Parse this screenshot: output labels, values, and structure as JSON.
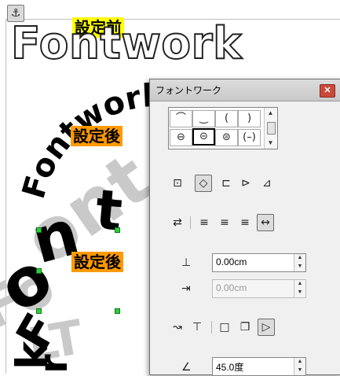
{
  "document": {
    "anchor_icon": "anchor-icon",
    "label_before": "設定前",
    "label_after_1": "設定後",
    "label_after_2": "設定後",
    "fontwork_text": "Fontwork",
    "colors": {
      "tag_before": "#ffff00",
      "tag_after": "#ff9a00",
      "handle": "#2ecc40"
    }
  },
  "dialog": {
    "title": "フォントワーク",
    "close_icon": "close-icon",
    "gallery": [
      "⌒",
      "‿",
      "(",
      ")",
      "⊖",
      "⊝",
      "⊜",
      "(–)"
    ],
    "mode_icons": [
      "off-icon",
      "rotate-icon",
      "upright-icon",
      "slant-horizontal-icon",
      "slant-vertical-icon"
    ],
    "orient_icons": [
      "orientation-icon",
      "align-left-icon",
      "align-center-icon",
      "align-right-icon",
      "autosize-icon"
    ],
    "distance_value": "0.00cm",
    "indent_value": "0.00cm",
    "contour_icons": [
      "contour-icon",
      "text-contour-icon",
      "shadow-off-icon",
      "shadow-vertical-icon",
      "shadow-slant-icon"
    ],
    "angle_value": "45.0度"
  }
}
